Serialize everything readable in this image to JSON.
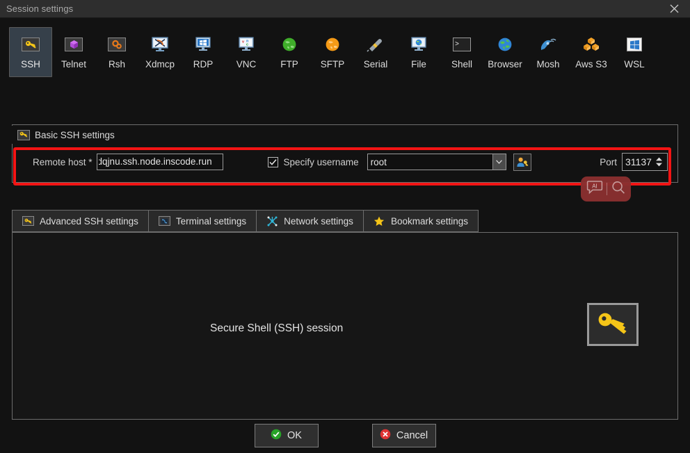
{
  "window": {
    "title": "Session settings",
    "close_icon": "close-icon"
  },
  "protocols": [
    {
      "label": "SSH",
      "icon": "key-icon",
      "selected": true
    },
    {
      "label": "Telnet",
      "icon": "purple-cube-icon",
      "selected": false
    },
    {
      "label": "Rsh",
      "icon": "orange-gears-icon",
      "selected": false
    },
    {
      "label": "Xdmcp",
      "icon": "x-monitor-icon",
      "selected": false
    },
    {
      "label": "RDP",
      "icon": "windows-monitor-icon",
      "selected": false
    },
    {
      "label": "VNC",
      "icon": "vnc-monitor-icon",
      "selected": false
    },
    {
      "label": "FTP",
      "icon": "green-globe-icon",
      "selected": false
    },
    {
      "label": "SFTP",
      "icon": "orange-globe-icon",
      "selected": false
    },
    {
      "label": "Serial",
      "icon": "serial-plug-icon",
      "selected": false
    },
    {
      "label": "File",
      "icon": "blue-globe-monitor-icon",
      "selected": false
    },
    {
      "label": "Shell",
      "icon": "terminal-prompt-icon",
      "selected": false
    },
    {
      "label": "Browser",
      "icon": "earth-globe-icon",
      "selected": false
    },
    {
      "label": "Mosh",
      "icon": "satellite-dish-icon",
      "selected": false
    },
    {
      "label": "Aws S3",
      "icon": "aws-s3-cubes-icon",
      "selected": false
    },
    {
      "label": "WSL",
      "icon": "windows-logo-icon",
      "selected": false
    }
  ],
  "basic_ssh": {
    "group_title": "Basic SSH settings",
    "group_icon": "key-icon",
    "host_label": "Remote host *",
    "host_value": "dqjnu.ssh.node.inscode.run",
    "host_placeholder": "Remote host",
    "specify_username_label": "Specify username",
    "specify_username_checked": true,
    "username_value": "root",
    "username_options": [
      "root"
    ],
    "username_dropdown_icon": "chevron-down-icon",
    "user_button_icon": "user-key-icon",
    "port_label": "Port",
    "port_value": "31137",
    "port_spinner_icon": "spinner-up-down-icon"
  },
  "annotation": {
    "highlight_color": "#f31414"
  },
  "ai_widget": {
    "ai_icon": "ai-bubble-icon",
    "ai_label": "AI",
    "search_icon": "search-icon",
    "background_color": "#8a3030"
  },
  "settings_tabs": [
    {
      "label": "Advanced SSH settings",
      "icon": "key-icon"
    },
    {
      "label": "Terminal settings",
      "icon": "terminal-settings-icon"
    },
    {
      "label": "Network settings",
      "icon": "network-nodes-icon"
    },
    {
      "label": "Bookmark settings",
      "icon": "star-icon"
    }
  ],
  "panel": {
    "caption": "Secure Shell (SSH) session",
    "big_icon": "key-icon"
  },
  "footer": {
    "ok_label": "OK",
    "ok_icon": "green-check-icon",
    "cancel_label": "Cancel",
    "cancel_icon": "red-x-icon"
  }
}
